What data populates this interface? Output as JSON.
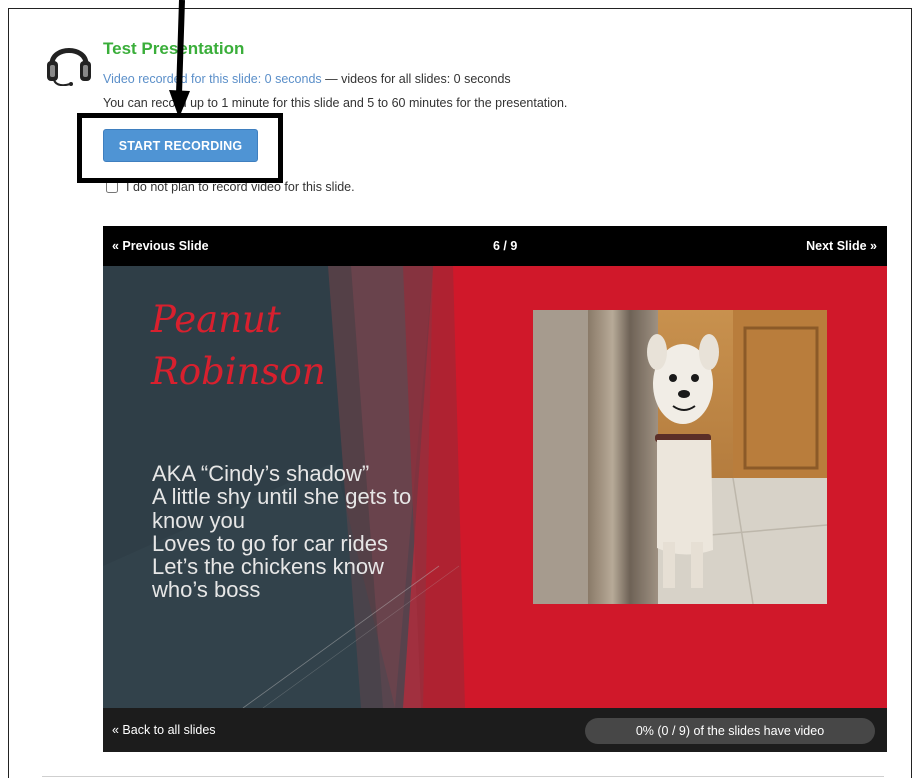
{
  "presentation": {
    "title": "Test Presentation",
    "video_status": {
      "link_text": "Video recorded for this slide: 0 seconds",
      "separator": " — ",
      "all_slides_text": "videos for all slides: 0 seconds"
    },
    "limit_text": "You can record up to 1 minute for this slide and 5 to 60 minutes for the presentation.",
    "start_recording_label": "START RECORDING",
    "no_video_label": "I do not plan to record video for this slide.",
    "no_video_checked": false
  },
  "slider": {
    "prev_label": "« Previous Slide",
    "counter": "6 / 9",
    "next_label": "Next Slide »",
    "slide": {
      "title_line1": "Peanut",
      "title_line2": "Robinson",
      "bullets": [
        "AKA “Cindy’s shadow”",
        "A little shy until she gets to",
        "know you",
        "Loves to go for car rides",
        "Let’s the chickens know",
        "who’s boss"
      ]
    },
    "back_label": "« Back to all slides",
    "progress_text": "0% (0 / 9) of the slides have video",
    "progress_fraction": 0
  },
  "colors": {
    "title_green": "#3aae3a",
    "link_blue": "#5b8fc9",
    "button_blue": "#4f94d4",
    "slide_red": "#d0182a",
    "slide_slate": "#2f3e47"
  }
}
